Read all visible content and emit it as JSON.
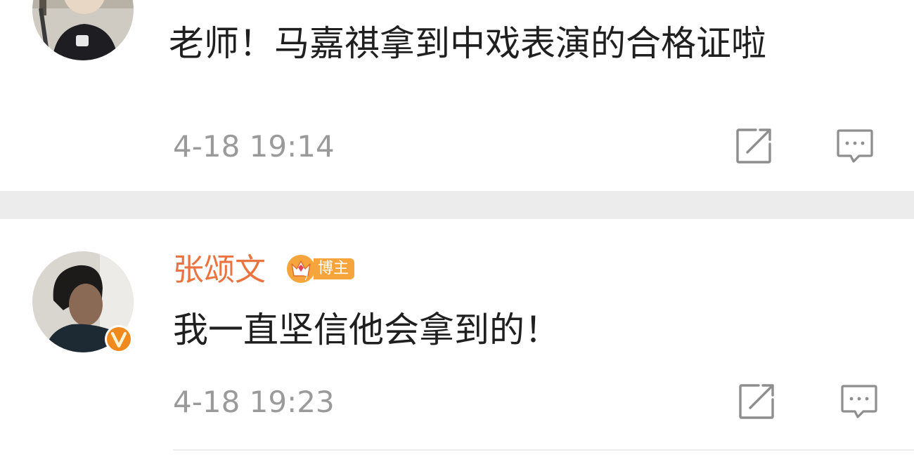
{
  "comments": [
    {
      "text": "老师！马嘉祺拿到中戏表演的合格证啦",
      "time": "4-18 19:14"
    },
    {
      "username": "张颂文",
      "badge_label": "博主",
      "text": "我一直坚信他会拿到的！",
      "time": "4-18 19:23"
    }
  ],
  "colors": {
    "username": "#eb7340",
    "badge": "#f6a43c",
    "verified": "#f08a1c",
    "meta": "#9a9a9a",
    "divider": "#ececec"
  },
  "icons": {
    "share": "share-external-icon",
    "comment": "comment-bubble-icon",
    "badge": "crown-icon",
    "verified": "verified-v-icon"
  }
}
